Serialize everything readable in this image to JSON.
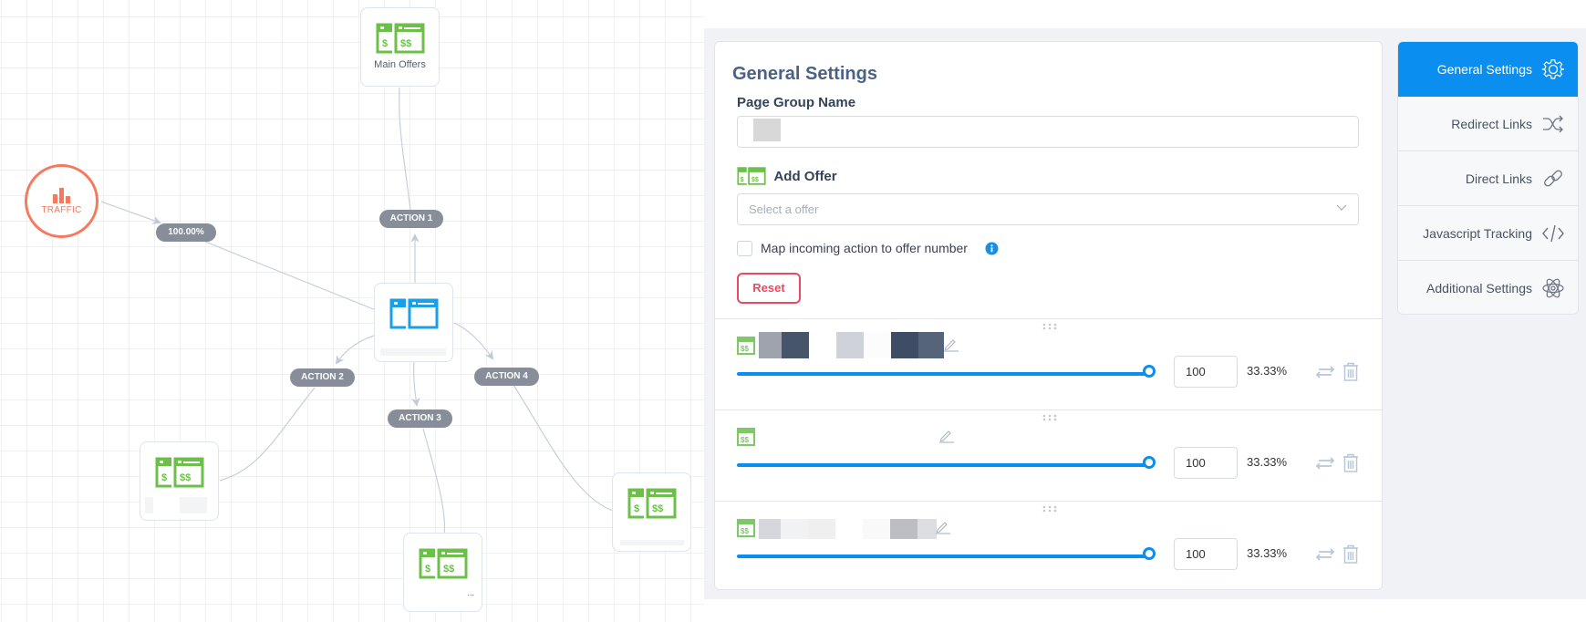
{
  "canvas": {
    "traffic": {
      "label": "TRAFFIC",
      "color": "#f6795e"
    },
    "edge_labels": {
      "traffic_pct": "100.00%",
      "action1": "ACTION 1",
      "action2": "ACTION 2",
      "action3": "ACTION 3",
      "action4": "ACTION 4"
    },
    "nodes": {
      "main_offers": {
        "label": "Main Offers",
        "icon": "offer-pages-icon"
      },
      "landing_page": {
        "label": "",
        "icon": "landing-page-icon"
      },
      "offer_left": {
        "label": "",
        "icon": "offer-pages-icon"
      },
      "offer_bottom": {
        "label": "...",
        "icon": "offer-pages-icon"
      },
      "offer_right": {
        "label": "",
        "icon": "offer-pages-icon"
      }
    }
  },
  "settings": {
    "title": "General Settings",
    "page_group_name": {
      "label": "Page Group Name",
      "value": ""
    },
    "add_offer": {
      "label": "Add Offer",
      "placeholder": "Select a offer"
    },
    "map_checkbox": {
      "label": "Map incoming action to offer number",
      "checked": false
    },
    "reset_label": "Reset",
    "offers": [
      {
        "name": "",
        "weight": "100",
        "percent": "33.33%",
        "slider_fraction": 1.0
      },
      {
        "name": "",
        "weight": "100",
        "percent": "33.33%",
        "slider_fraction": 1.0
      },
      {
        "name": "",
        "weight": "100",
        "percent": "33.33%",
        "slider_fraction": 1.0
      }
    ]
  },
  "tabs": [
    {
      "label": "General Settings",
      "icon": "gear-icon",
      "active": true
    },
    {
      "label": "Redirect Links",
      "icon": "shuffle-icon",
      "active": false
    },
    {
      "label": "Direct Links",
      "icon": "link-icon",
      "active": false
    },
    {
      "label": "Javascript Tracking",
      "icon": "code-icon",
      "active": false
    },
    {
      "label": "Additional Settings",
      "icon": "atom-icon",
      "active": false
    }
  ],
  "colors": {
    "accent": "#0a8ef0",
    "offer_green": "#6cc04a",
    "danger": "#ea4a60",
    "pill_gray": "#878d99"
  }
}
